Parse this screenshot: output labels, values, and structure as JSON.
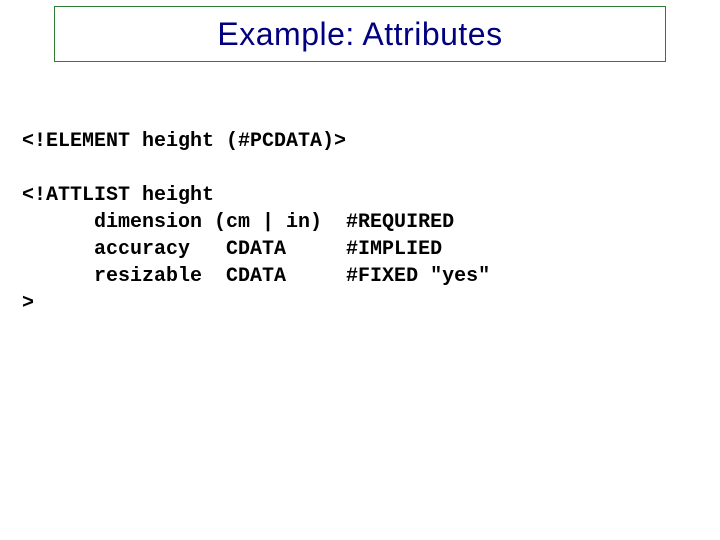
{
  "title": "Example: Attributes",
  "code": {
    "line1": "<!ELEMENT height (#PCDATA)>",
    "blank1": "",
    "line2": "<!ATTLIST height",
    "line3": "      dimension (cm | in)  #REQUIRED",
    "line4": "      accuracy   CDATA     #IMPLIED",
    "line5": "      resizable  CDATA     #FIXED \"yes\"",
    "line6": ">"
  }
}
